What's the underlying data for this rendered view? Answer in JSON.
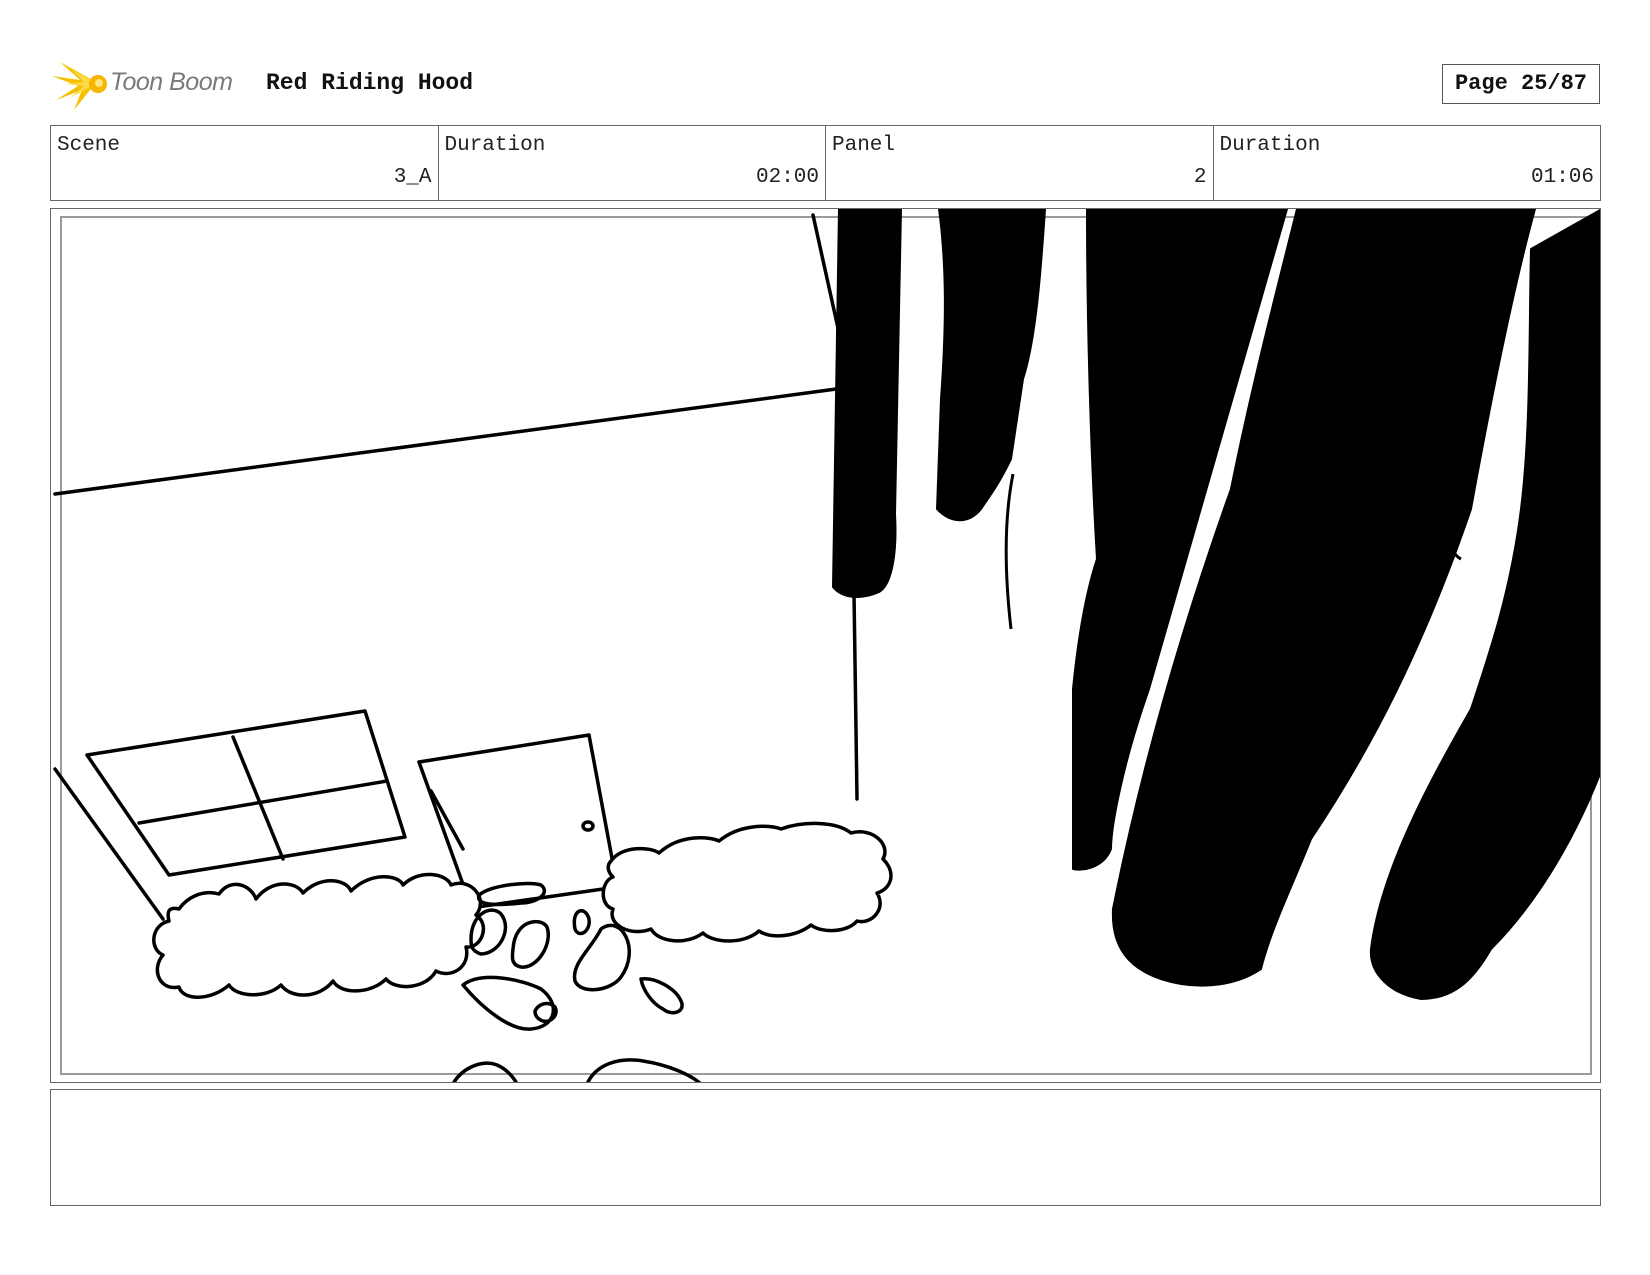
{
  "header": {
    "logo_text": "Toon Boom",
    "title": "Red Riding Hood",
    "page": "Page 25/87"
  },
  "info": {
    "scene_label": "Scene",
    "scene_value": "3_A",
    "scene_duration_label": "Duration",
    "scene_duration_value": "02:00",
    "panel_label": "Panel",
    "panel_value": "2",
    "panel_duration_label": "Duration",
    "panel_duration_value": "01:06"
  },
  "colors": {
    "logo_accent": "#f5c000",
    "ink": "#000000",
    "border": "#666666"
  },
  "notes": ""
}
